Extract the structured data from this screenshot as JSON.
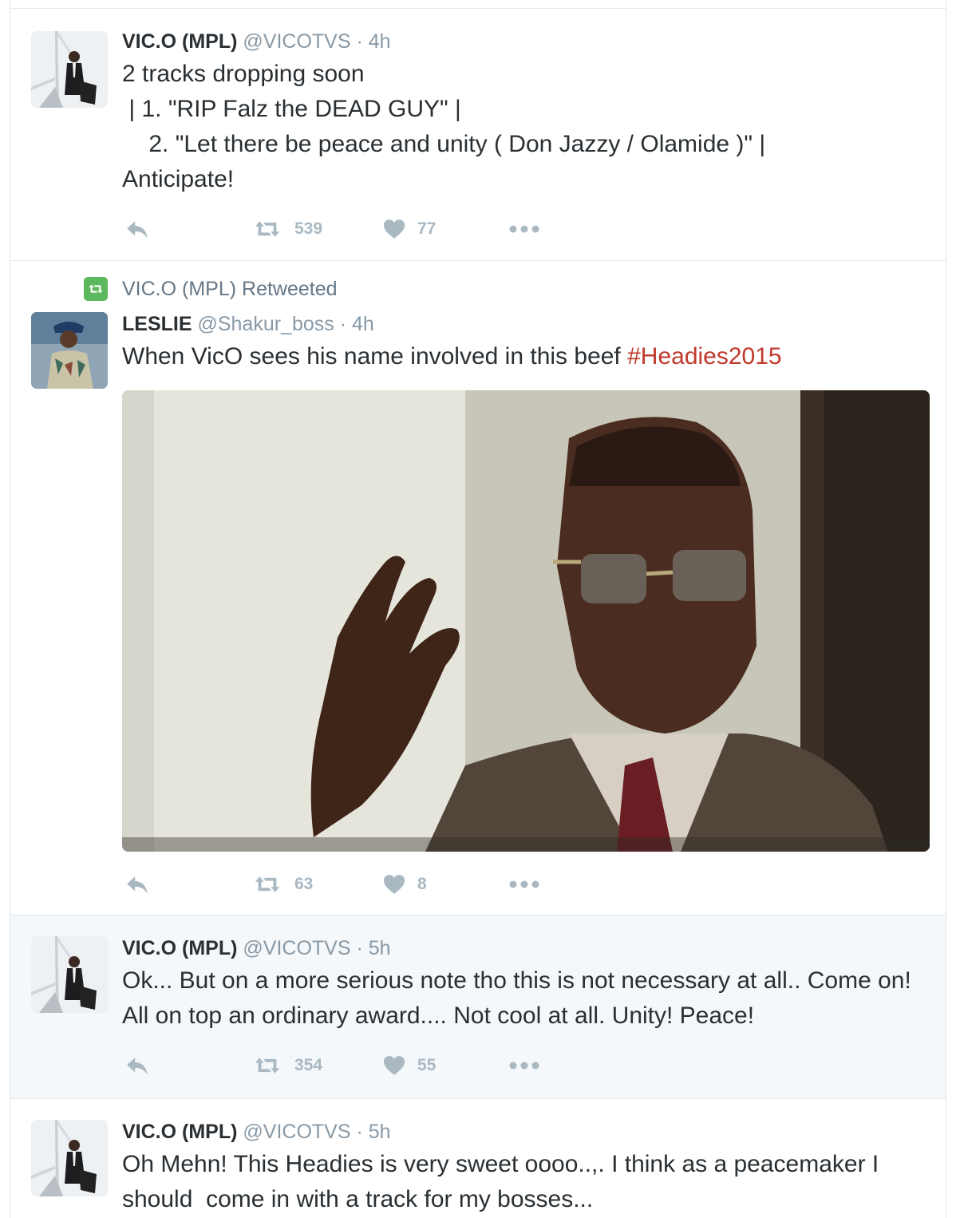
{
  "tweets": [
    {
      "name": "VIC.O (MPL)",
      "handle": "@VICOTVS",
      "dot": "·",
      "time": "4h",
      "text": "2 tracks dropping soon\n | 1. \"RIP Falz the DEAD GUY\" |\n    2. \"Let there be peace and unity ( Don Jazzy / Olamide )\" |\nAnticipate!",
      "retweets": "539",
      "likes": "77"
    },
    {
      "retweet_context": "VIC.O (MPL) Retweeted",
      "name": "LESLIE",
      "handle": "@Shakur_boss",
      "dot": "·",
      "time": "4h",
      "text": "When VicO sees his name involved in this beef ",
      "hashtag": "#Headies2015",
      "retweets": "63",
      "likes": "8"
    },
    {
      "name": "VIC.O (MPL)",
      "handle": "@VICOTVS",
      "dot": "·",
      "time": "5h",
      "text": "Ok... But on a more serious note tho this is not necessary at all.. Come on! All on top an ordinary award.... Not cool at all. Unity! Peace!",
      "retweets": "354",
      "likes": "55"
    },
    {
      "name": "VIC.O (MPL)",
      "handle": "@VICOTVS",
      "dot": "·",
      "time": "5h",
      "text": "Oh Mehn! This Headies is very sweet oooo..,. I think as a peacemaker I should  come in with a track for my bosses..."
    }
  ],
  "icons": {
    "reply": "reply-icon",
    "retweet": "retweet-icon",
    "like": "heart-icon",
    "more": "more-icon"
  },
  "colors": {
    "action_gray": "#aab8c2",
    "hashtag": "#c0392b",
    "retweet_green": "#5cb85c",
    "hover_bg": "#f5f8fa"
  }
}
